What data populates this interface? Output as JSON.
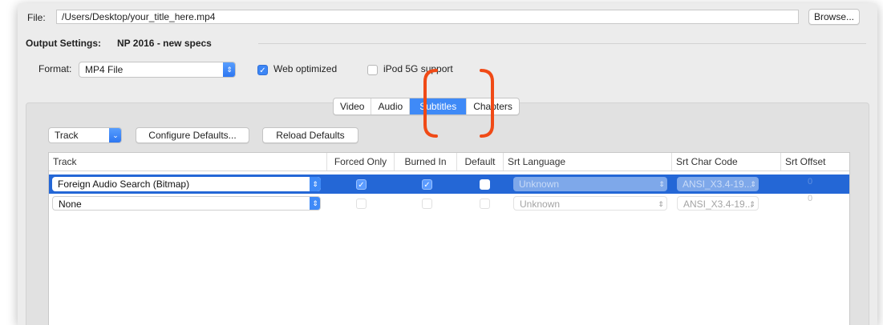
{
  "file": {
    "label": "File:",
    "path": "/Users/Desktop/your_title_here.mp4",
    "browse_label": "Browse..."
  },
  "output_settings": {
    "label": "Output Settings:",
    "preset": "NP 2016 - new specs"
  },
  "format": {
    "label": "Format:",
    "value": "MP4 File",
    "web_optimized_label": "Web optimized",
    "web_optimized_checked": true,
    "ipod_label": "iPod 5G support",
    "ipod_checked": false
  },
  "tabs": [
    {
      "label": "Video",
      "active": false
    },
    {
      "label": "Audio",
      "active": false
    },
    {
      "label": "Subtitles",
      "active": true
    },
    {
      "label": "Chapters",
      "active": false
    }
  ],
  "subtitle_toolbar": {
    "track_popup": "Track",
    "configure_defaults": "Configure Defaults...",
    "reload_defaults": "Reload Defaults"
  },
  "table": {
    "columns": [
      "Track",
      "Forced Only",
      "Burned In",
      "Default",
      "Srt Language",
      "Srt Char Code",
      "Srt Offset"
    ],
    "rows": [
      {
        "track": "Foreign Audio Search (Bitmap)",
        "forced_only": true,
        "burned_in": true,
        "default": false,
        "srt_language": "Unknown",
        "srt_char_code": "ANSI_X3.4-19...",
        "srt_offset": "0",
        "selected": true
      },
      {
        "track": "None",
        "forced_only": false,
        "burned_in": false,
        "default": false,
        "srt_language": "Unknown",
        "srt_char_code": "ANSI_X3.4-19...",
        "srt_offset": "0",
        "selected": false
      }
    ]
  },
  "colors": {
    "accent": "#3f8af7",
    "selection": "#2467d6",
    "annotation": "#f04a16"
  }
}
